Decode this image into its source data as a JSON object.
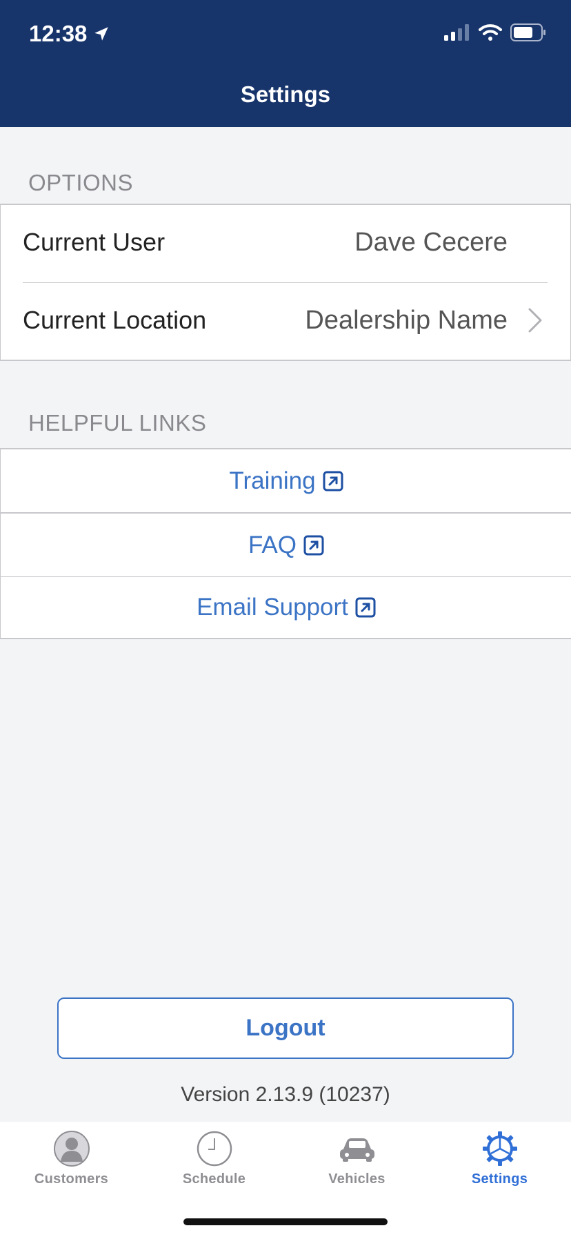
{
  "status_bar": {
    "time": "12:38"
  },
  "nav": {
    "title": "Settings"
  },
  "options": {
    "header": "OPTIONS",
    "current_user": {
      "label": "Current User",
      "value": "Dave Cecere"
    },
    "current_location": {
      "label": "Current Location",
      "value": "Dealership Name"
    }
  },
  "helpful_links": {
    "header": "HELPFUL LINKS",
    "items": [
      {
        "label": "Training"
      },
      {
        "label": "FAQ"
      },
      {
        "label": "Email Support"
      }
    ]
  },
  "logout_label": "Logout",
  "version": "Version 2.13.9 (10237)",
  "tabs": [
    {
      "label": "Customers",
      "icon": "person-icon",
      "active": false
    },
    {
      "label": "Schedule",
      "icon": "clock-icon",
      "active": false
    },
    {
      "label": "Vehicles",
      "icon": "car-icon",
      "active": false
    },
    {
      "label": "Settings",
      "icon": "gear-icon",
      "active": true
    }
  ],
  "colors": {
    "header_bg": "#17346b",
    "accent": "#3b73c5",
    "active_tab": "#2f6fd6",
    "background": "#f3f4f6"
  }
}
